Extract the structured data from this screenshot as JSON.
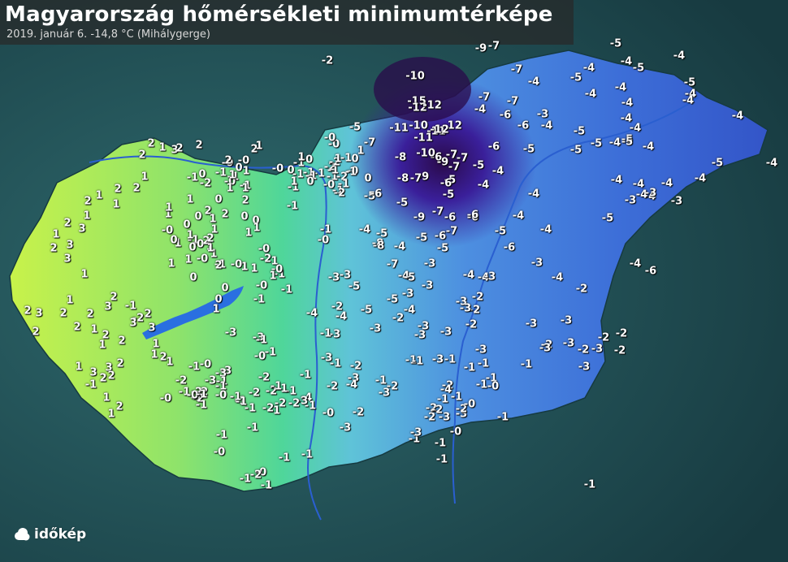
{
  "title": "Magyarország hőmérsékleti minimumtérképe",
  "subtitle": "2019. január 6.  -14,8 °C (Mihálygerge)",
  "logo_text": "időkép",
  "colors": {
    "background_terrain": "#1f4a4f",
    "warm_west": "#c8f24a",
    "mid_green": "#4fd69a",
    "cyan": "#5fc3d8",
    "blue": "#3d6fd8",
    "cold_purple": "#3a1f9a",
    "coldest": "#2a0a4a",
    "lake": "#2a6fe0",
    "label_text": "#ffffff"
  },
  "station_values": [
    "-9",
    "-7",
    "-2",
    "-5",
    "-4",
    "-4",
    "-7",
    "-5",
    "-5",
    "-4",
    "-4",
    "-5",
    "-4",
    "-10",
    "-4",
    "-4",
    "-15",
    "-7",
    "-4",
    "-4",
    "-12",
    "-12",
    "-7",
    "-4",
    "-4",
    "-6",
    "-3",
    "-6",
    "-5",
    "-5",
    "-11",
    "-10",
    "-11",
    "-12",
    "-12",
    "-4",
    "-4",
    "-7",
    "-4",
    "-5",
    "-5",
    "-11",
    "-6",
    "-5",
    "-5",
    "-4",
    "-4",
    "-5",
    "-7",
    "-6",
    "-8",
    "-10",
    "-9",
    "-7",
    "-5",
    "-4",
    "-5",
    "-7",
    "-4",
    "-8",
    "-9",
    "-7",
    "-5",
    "-6",
    "-4",
    "-4",
    "-4",
    "-4",
    "-4",
    "-5",
    "-6",
    "-3",
    "-3",
    "-4",
    "-4",
    "-4",
    "-3",
    "-5",
    "-6",
    "-5",
    "-5",
    "-9",
    "-7",
    "-6",
    "-4",
    "-6",
    "-4",
    "-5",
    "-4",
    "-8",
    "-3",
    "-8",
    "-4",
    "-5",
    "-7",
    "-6",
    "-5",
    "-6",
    "-4",
    "-7",
    "-4",
    "-3",
    "-3",
    "-4",
    "-5",
    "-5",
    "-6",
    "-4",
    "-3",
    "-4",
    "-5",
    "-3",
    "-3",
    "-2",
    "-5",
    "-3",
    "-4",
    "-3",
    "-2",
    "-2",
    "-5",
    "-4",
    "-2",
    "-3",
    "-3",
    "-2",
    "-2",
    "-3",
    "-4",
    "-3",
    "-3",
    "-2",
    "-3",
    "-3",
    "-3",
    "-1",
    "-2",
    "-3",
    "-2",
    "-2",
    "-3",
    "-3",
    "-3",
    "-3",
    "-1",
    "-2",
    "-3",
    "-3",
    "-1",
    "-1",
    "-2",
    "-3",
    "-0",
    "-1",
    "-1",
    "-0",
    "-1",
    "-3",
    "-1",
    "-3",
    "-1",
    "-2",
    "-1",
    "-1",
    "-1",
    "-3",
    "-3",
    "-1",
    "-3",
    "-2",
    "-2",
    "-4",
    "-2",
    "-2",
    "-1",
    "-3",
    "-2",
    "-1",
    "-4",
    "-1",
    "-2",
    "-4",
    "-2",
    "-1",
    "-1",
    "-1",
    "-3",
    "-3",
    "-2",
    "-1",
    "-0",
    "-2",
    "-2",
    "-2",
    "-1",
    "-0",
    "-1",
    "-3",
    "-2",
    "-3",
    "-1",
    "-0",
    "-1",
    "-1",
    "-0",
    "-1",
    "-1",
    "-1",
    "-1",
    "-3",
    "-1",
    "-1",
    "-0",
    "-0",
    "-0",
    "-1",
    "-1",
    "-1",
    "-1",
    "-1",
    "-2",
    "-2",
    "-1",
    "-0",
    "-1",
    "-0",
    "-2",
    "-1",
    "-1",
    "-1",
    "-1",
    "-2",
    "-2",
    "-1",
    "-2",
    "-1",
    "-1",
    "-1",
    "-1",
    "-1",
    "-1",
    "-0",
    "-0",
    "-1",
    "-2",
    "-1",
    "-1",
    "0",
    "-0",
    "-1",
    "-1",
    "1",
    "-1",
    "-1",
    "0",
    "-0",
    "-1",
    "-2",
    "-0",
    "-2",
    "-1",
    "-2",
    "0",
    "-1",
    "-1",
    "-0",
    "1",
    "-0",
    "-2",
    "1",
    "-1",
    "0",
    "-1",
    "-1",
    "1",
    "0",
    "-0",
    "1",
    "-0",
    "-1",
    "1",
    "-0",
    "2",
    "0",
    "0",
    "-1",
    "-0",
    "-0",
    "1",
    "1",
    "-1",
    "0",
    "1",
    "0",
    "0",
    "1",
    "0",
    "1",
    "0",
    "2",
    "0",
    "1",
    "1",
    "-0",
    "-2",
    "1",
    "-0",
    "1",
    "-0",
    "1",
    "1",
    "-0",
    "1",
    "1",
    "0",
    "-0",
    "1",
    "1",
    "1",
    "0",
    "2",
    "1",
    "1",
    "2",
    "2",
    "2",
    "1",
    "1",
    "1",
    "2",
    "1",
    "2",
    "0",
    "2",
    "3",
    "1",
    "2",
    "2",
    "2",
    "1",
    "2",
    "2",
    "1",
    "1",
    "2",
    "1",
    "3",
    "2",
    "3",
    "1",
    "2",
    "3",
    "1",
    "1",
    "2",
    "3",
    "2",
    "2",
    "2",
    "2",
    "3",
    "2",
    "-1",
    "-2",
    "2",
    "3",
    "3",
    "2",
    "1",
    "1",
    "2",
    "1",
    "1",
    "1",
    "2",
    "3",
    "2",
    "2",
    "2",
    "1",
    "2",
    "1",
    "3",
    "-1",
    "1"
  ]
}
